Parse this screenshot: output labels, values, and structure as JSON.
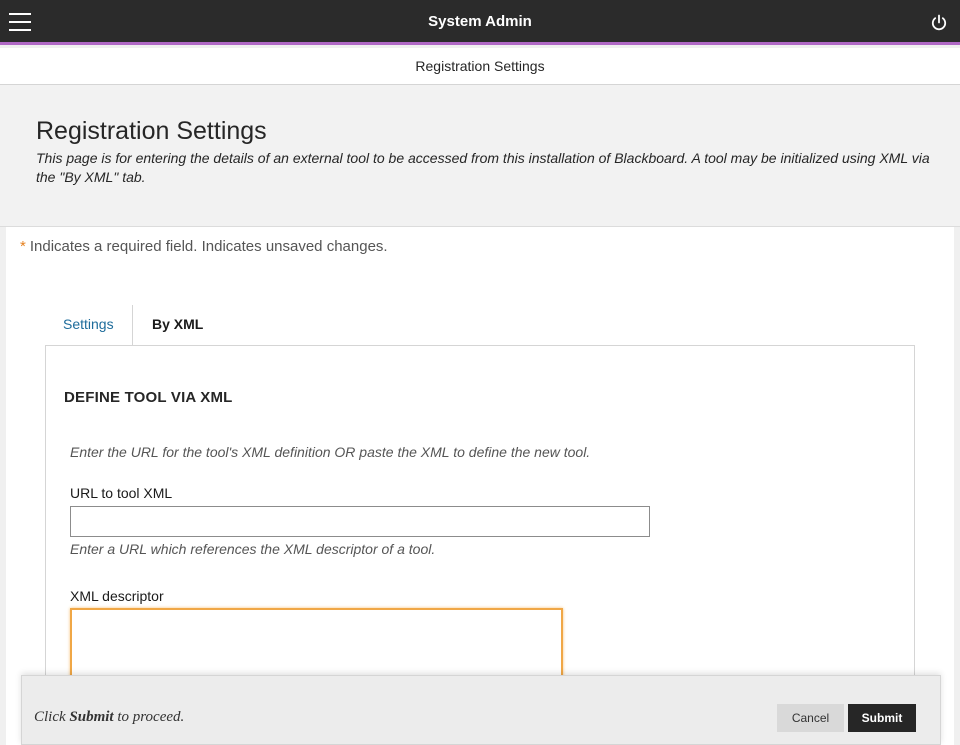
{
  "topbar": {
    "title": "System Admin",
    "menu_icon": "hamburger-menu-icon",
    "power_icon": "power-icon",
    "accent_color": "#b068c5"
  },
  "breadcrumb": "Registration Settings",
  "header": {
    "title": "Registration Settings",
    "description": "This page is for entering the details of an external tool to be accessed from this installation of Blackboard. A tool may be initialized using XML via the \"By XML\" tab."
  },
  "required_note": {
    "star": "*",
    "text": "Indicates a required field. Indicates unsaved changes."
  },
  "tabs": [
    {
      "label": "Settings",
      "active": false
    },
    {
      "label": "By XML",
      "active": true
    }
  ],
  "section": {
    "heading": "DEFINE TOOL VIA XML",
    "instructions": "Enter the URL for the tool's XML definition OR paste the XML to define the new tool.",
    "url_label": "URL to tool XML",
    "url_value": "",
    "url_help": "Enter a URL which references the XML descriptor of a tool.",
    "xml_label": "XML descriptor",
    "xml_value": ""
  },
  "footer": {
    "prefix": "Click ",
    "bold": "Submit",
    "suffix": " to proceed.",
    "cancel_label": "Cancel",
    "submit_label": "Submit"
  }
}
